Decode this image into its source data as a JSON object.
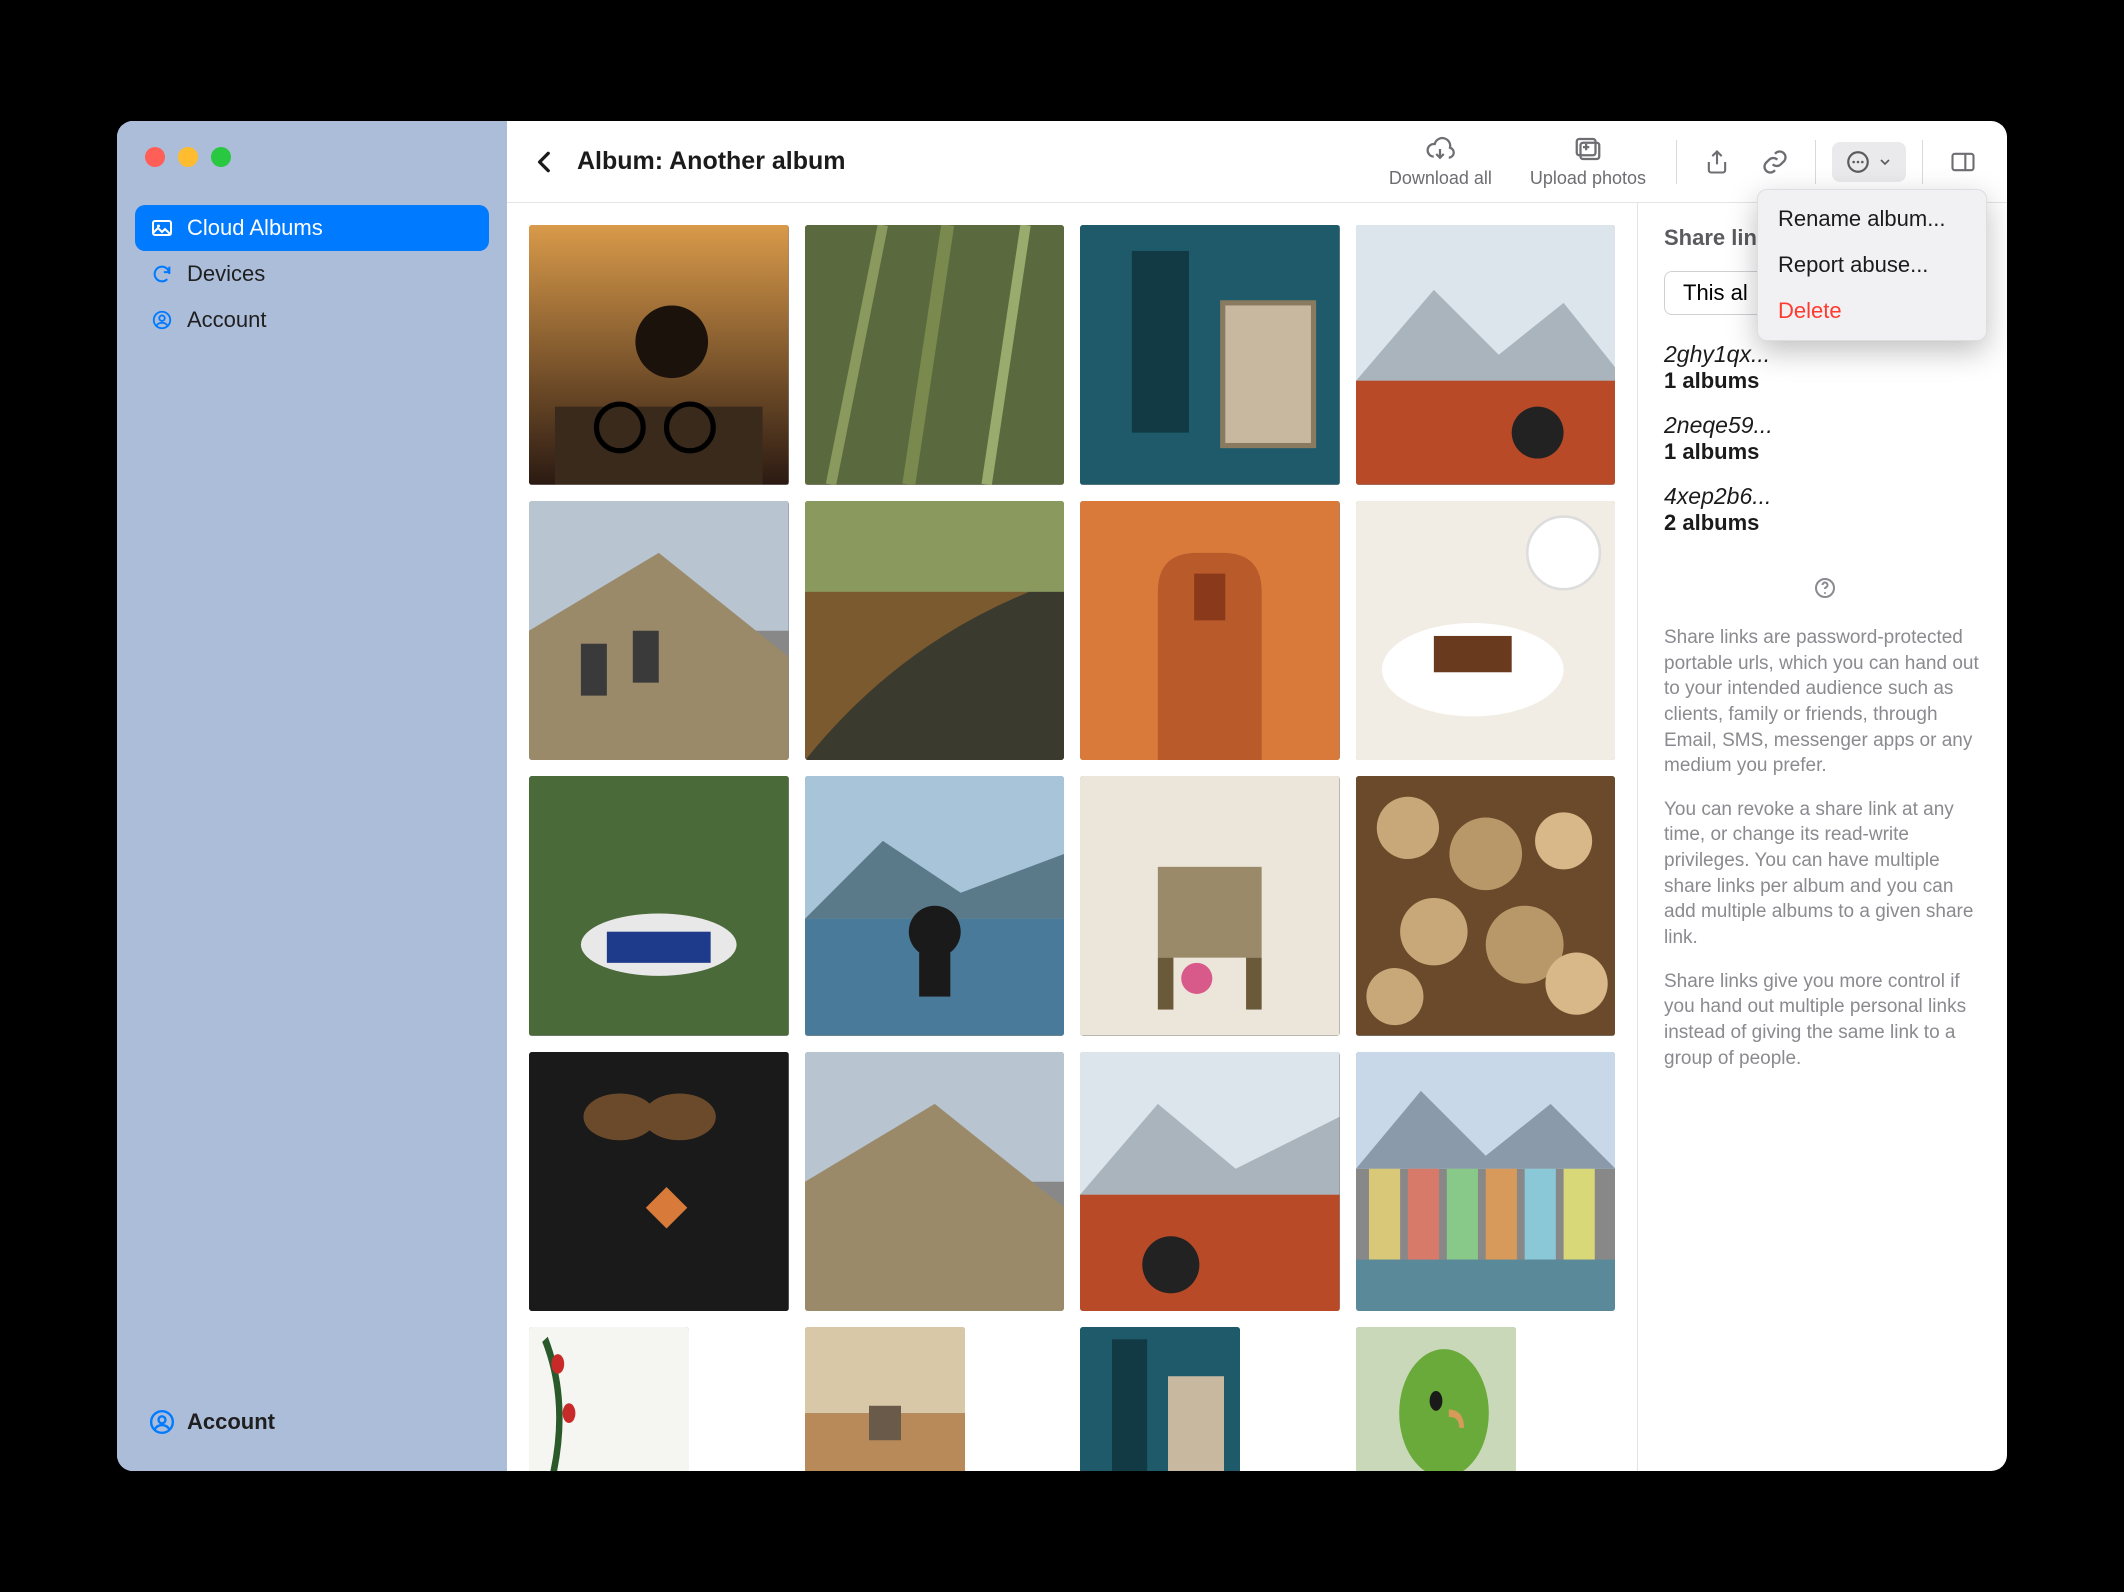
{
  "sidebar": {
    "items": [
      {
        "label": "Cloud Albums",
        "icon": "picture"
      },
      {
        "label": "Devices",
        "icon": "sync"
      },
      {
        "label": "Account",
        "icon": "person"
      }
    ],
    "footer": {
      "label": "Account",
      "icon": "person"
    }
  },
  "toolbar": {
    "title": "Album: Another album",
    "download_label": "Download all",
    "upload_label": "Upload photos"
  },
  "dropdown": {
    "rename": "Rename album...",
    "report": "Report abuse...",
    "delete": "Delete"
  },
  "panel": {
    "title": "Share links",
    "pill_label": "This al",
    "links": [
      {
        "key": "2ghy1qx...",
        "sub": "1 albums"
      },
      {
        "key": "2neqe59...",
        "sub": "1 albums"
      },
      {
        "key": "4xep2b6...",
        "sub": "2 albums"
      }
    ],
    "help": [
      "Share links are password-protected portable urls, which you can hand out to your intended audience such as clients, family or friends, through Email, SMS, messenger apps or any medium you prefer.",
      "You can revoke a share link at any time, or change its read-write privileges. You can have multiple share links per album and you can add multiple albums to a given share link.",
      "Share links give you more control if you hand out multiple personal links instead of giving the same link to a group of people."
    ]
  }
}
